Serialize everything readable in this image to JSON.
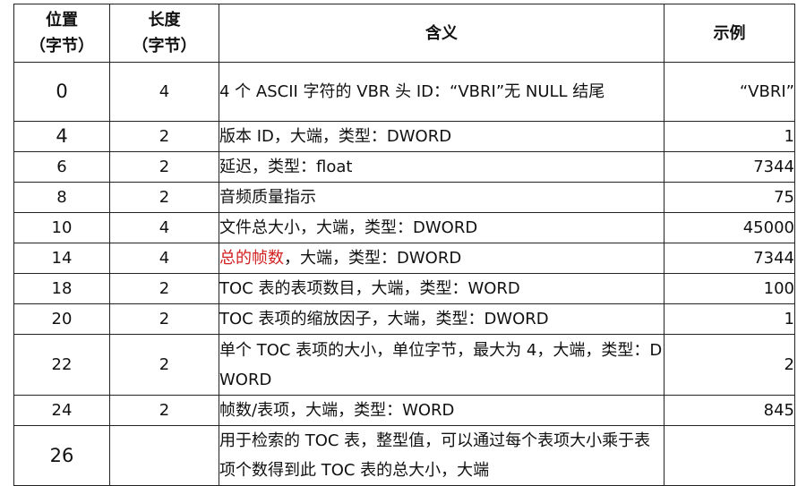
{
  "table": {
    "headers": {
      "position": [
        "位置",
        "（字节）"
      ],
      "length": [
        "长度",
        "（字节）"
      ],
      "meaning": "含义",
      "example": "示例"
    },
    "rows": [
      {
        "pos": "0",
        "len": "4",
        "desc": "4 个 ASCII 字符的 VBR 头 ID：“VBRI”无 NULL 结尾",
        "example": "“VBRI”"
      },
      {
        "pos": "4",
        "len": "2",
        "desc": "版本 ID，大端，类型：DWORD",
        "example": "1"
      },
      {
        "pos": "6",
        "len": "2",
        "desc": "延迟，类型：float",
        "example": "7344"
      },
      {
        "pos": "8",
        "len": "2",
        "desc": "音频质量指示",
        "example": "75"
      },
      {
        "pos": "10",
        "len": "4",
        "desc": "文件总大小，大端，类型：DWORD",
        "example": "45000"
      },
      {
        "pos": "14",
        "len": "4",
        "desc_highlight": "总的帧数",
        "desc_rest": "，大端，类型：DWORD",
        "example": "7344"
      },
      {
        "pos": "18",
        "len": "2",
        "desc": "TOC 表的表项数目，大端，类型：WORD",
        "example": "100"
      },
      {
        "pos": "20",
        "len": "2",
        "desc": "TOC 表项的缩放因子，大端，类型：DWORD",
        "example": "1"
      },
      {
        "pos": "22",
        "len": "2",
        "desc": "单个 TOC 表项的大小，单位字节，最大为 4，大端，类型：DWORD",
        "example": "2"
      },
      {
        "pos": "24",
        "len": "2",
        "desc": "帧数/表项，大端，类型：WORD",
        "example": "845"
      },
      {
        "pos": "26",
        "len": "",
        "desc": "用于检索的 TOC 表，整型值，可以通过每个表项大小乘于表项个数得到此 TOC 表的总大小，大端",
        "example": ""
      }
    ]
  },
  "colors": {
    "highlight": "#d32222",
    "text": "#111111",
    "border": "#222222"
  }
}
